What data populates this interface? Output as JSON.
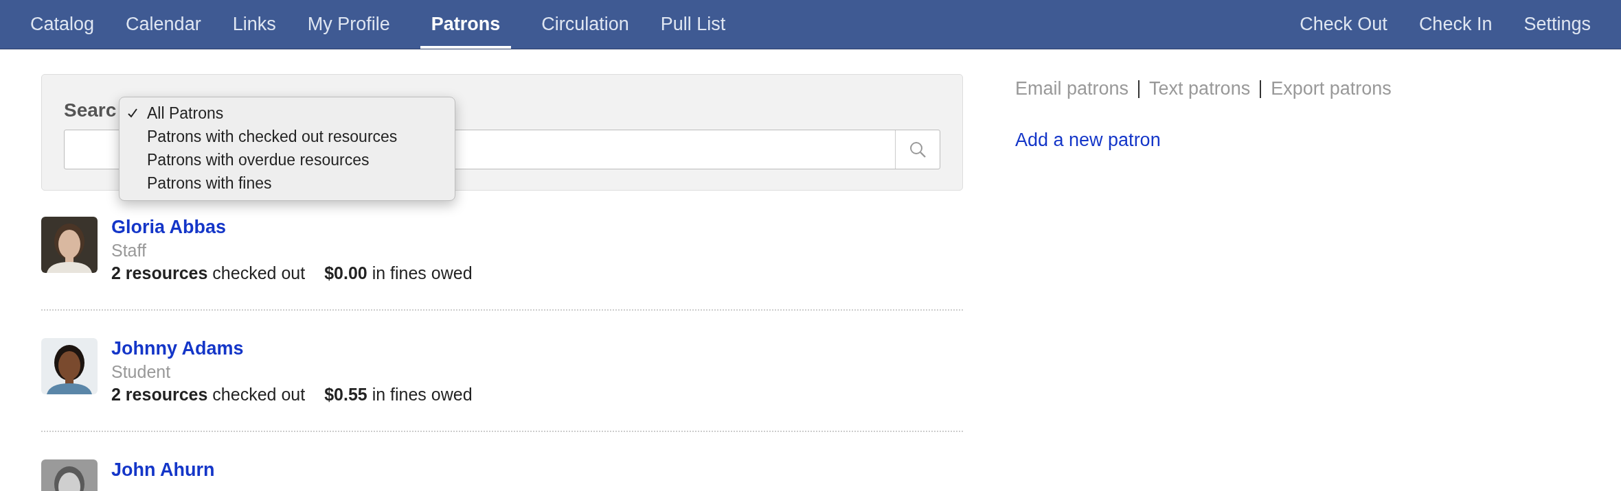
{
  "nav": {
    "left": [
      {
        "label": "Catalog",
        "selected": false
      },
      {
        "label": "Calendar",
        "selected": false
      },
      {
        "label": "Links",
        "selected": false
      },
      {
        "label": "My Profile",
        "selected": false
      },
      {
        "label": "Patrons",
        "selected": true
      },
      {
        "label": "Circulation",
        "selected": false
      },
      {
        "label": "Pull List",
        "selected": false
      }
    ],
    "right": [
      {
        "label": "Check Out",
        "selected": false
      },
      {
        "label": "Check In",
        "selected": false
      },
      {
        "label": "Settings",
        "selected": false
      }
    ]
  },
  "search": {
    "label": "Searc",
    "filter_menu": [
      {
        "label": "All Patrons",
        "selected": true
      },
      {
        "label": "Patrons with checked out resources",
        "selected": false
      },
      {
        "label": "Patrons with overdue resources",
        "selected": false
      },
      {
        "label": "Patrons with fines",
        "selected": false
      }
    ]
  },
  "patrons": [
    {
      "name": "Gloria Abbas",
      "role": "Staff",
      "resources": "2 resources",
      "resources_text": "checked out",
      "fines": "$0.00",
      "fines_text": "in fines owed"
    },
    {
      "name": "Johnny Adams",
      "role": "Student",
      "resources": "2 resources",
      "resources_text": "checked out",
      "fines": "$0.55",
      "fines_text": "in fines owed"
    },
    {
      "name": "John Ahurn"
    }
  ],
  "actions": [
    "Email patrons",
    "Text patrons",
    "Export patrons"
  ],
  "add_link": "Add a new patron"
}
